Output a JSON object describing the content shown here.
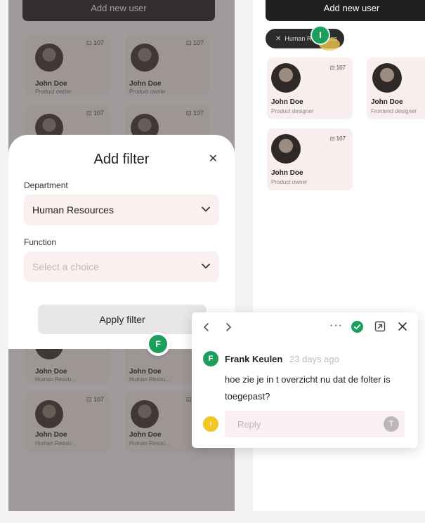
{
  "left_screen": {
    "add_button_label": "Add new user",
    "cards": [
      {
        "name": "John Doe",
        "role": "Product owner",
        "count": "107"
      },
      {
        "name": "John Doe",
        "role": "Product owner",
        "count": "107"
      },
      {
        "name": "John Doe",
        "role": "",
        "count": "107"
      },
      {
        "name": "John Doe",
        "role": "",
        "count": "107"
      },
      {
        "name": "John Doe",
        "role": "Human Resou...",
        "count": ""
      },
      {
        "name": "John Doe",
        "role": "Human Resou...",
        "count": ""
      },
      {
        "name": "John Doe",
        "role": "Human Resou...",
        "count": "107"
      },
      {
        "name": "John Doe",
        "role": "Human Resou...",
        "count": "107"
      }
    ]
  },
  "right_screen": {
    "add_button_label": "Add new user",
    "filter_chip_label": "Human Resources",
    "chip_user_initial": "I",
    "cards": [
      {
        "name": "John Doe",
        "role": "Product designer",
        "count": "107"
      },
      {
        "name": "John Doe",
        "role": "Frontend designer",
        "count": ""
      },
      {
        "name": "John Doe",
        "role": "Product owner",
        "count": "107"
      }
    ]
  },
  "filter_modal": {
    "title": "Add filter",
    "department_label": "Department",
    "department_value": "Human Resources",
    "function_label": "Function",
    "function_placeholder": "Select a choice",
    "apply_label": "Apply filter"
  },
  "marker_initial": "F",
  "comment": {
    "author_initial": "F",
    "author": "Frank Keulen",
    "time": "23 days ago",
    "body": "hoe zie je in t overzicht nu dat de folter is toegepast?",
    "reply_initial": "I",
    "reply_placeholder": "Reply",
    "send_initial": "T"
  },
  "colors": {
    "accent_green": "#1e9e5c",
    "dark_button": "#1f1f1f",
    "card_bg": "#f6ecec",
    "reply_avatar": "#f5c625"
  }
}
